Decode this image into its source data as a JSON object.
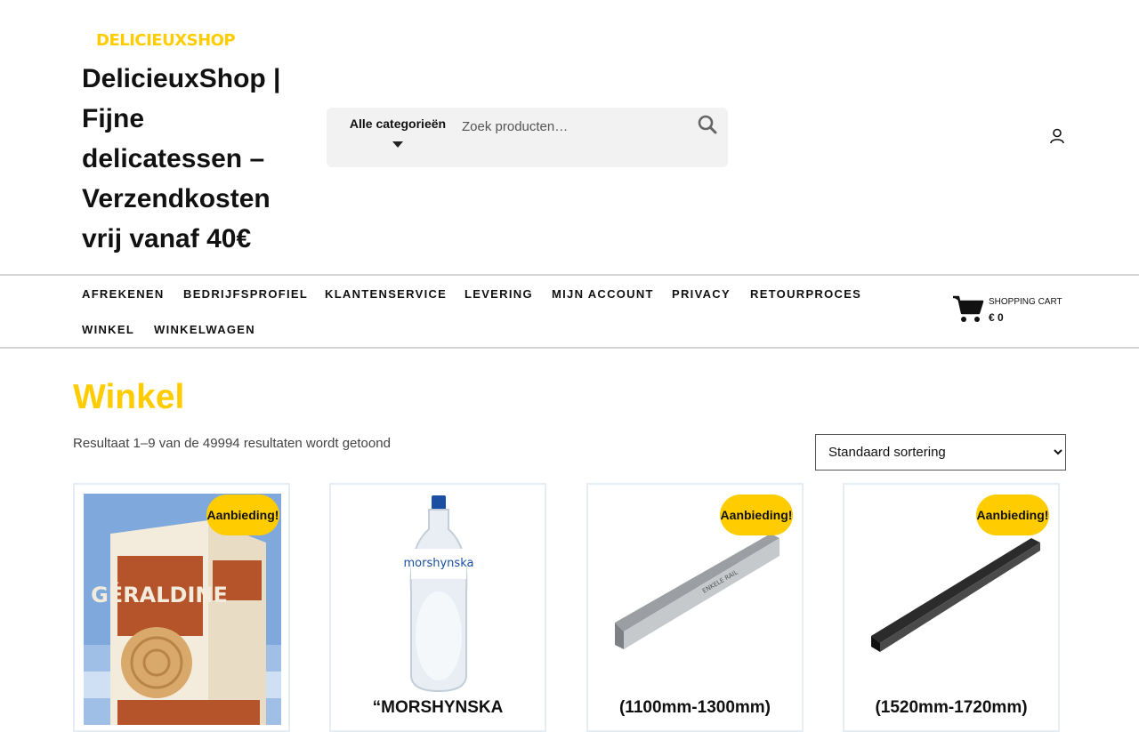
{
  "header": {
    "logo_text": "DelicieuxShop",
    "site_title": "DelicieuxShop | Fijne delicatessen – Verzendkosten vrij vanaf 40€"
  },
  "search": {
    "category_label": "Alle categorieën",
    "placeholder": "Zoek producten…",
    "icon": "search-icon"
  },
  "account": {
    "icon": "user-icon"
  },
  "nav": {
    "items": [
      "Afrekenen",
      "Bedrijfsprofiel",
      "Klantenservice",
      "Levering",
      "Mijn account",
      "Privacy",
      "Retourproces",
      "Winkel",
      "Winkelwagen"
    ]
  },
  "cart": {
    "label": "SHOPPING CART",
    "amount": "€ 0",
    "icon": "shopping-cart-icon"
  },
  "shop": {
    "title": "Winkel",
    "result_count": "Resultaat 1–9 van de 49994 resultaten wordt getoond",
    "sort_selected": "Standaard sortering"
  },
  "products": [
    {
      "title": "",
      "badge": "Aanbieding!",
      "image": "geraldine-biscuits-box"
    },
    {
      "title": "“MORSHYNSKA",
      "badge": "",
      "image": "morshynska-water-bottle"
    },
    {
      "title": "(1100mm-1300mm)",
      "badge": "Aanbieding!",
      "image": "grey-metal-rail"
    },
    {
      "title": "(1520mm-1720mm)",
      "badge": "Aanbieding!",
      "image": "black-metal-rail"
    }
  ],
  "colors": {
    "accent": "#ffcc00",
    "text": "#111111",
    "search_bg": "#f2f2f2",
    "card_border": "#e6edf5"
  }
}
